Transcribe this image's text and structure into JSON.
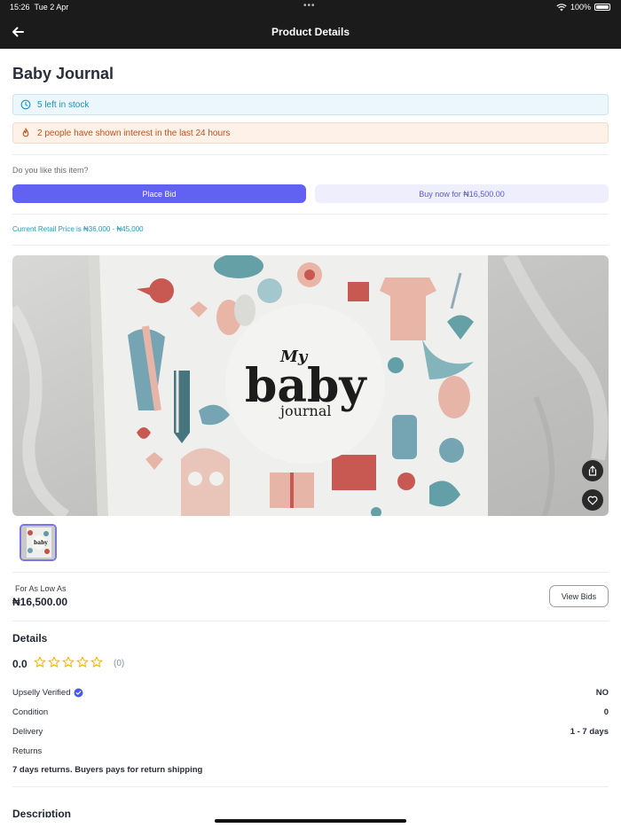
{
  "status_bar": {
    "time": "15:26",
    "date": "Tue 2 Apr",
    "battery": "100%"
  },
  "header": {
    "title": "Product Details"
  },
  "product": {
    "name": "Baby Journal",
    "stock_notice": "5 left in stock",
    "interest_notice": "2 people have shown interest in the last 24 hours",
    "like_question": "Do you like this item?",
    "place_bid_label": "Place Bid",
    "buy_now_label": "Buy now for ₦16,500.00",
    "retail_price_text": "Current Retail Price is ₦36,000 - ₦45,000",
    "cover_text": {
      "line1": "My",
      "line2": "baby",
      "line3": "journal"
    },
    "thumb_text": "baby"
  },
  "pricing": {
    "low_label": "For As Low As",
    "low_price": "₦16,500.00",
    "view_bids_label": "View Bids"
  },
  "details": {
    "heading": "Details",
    "rating_value": "0.0",
    "rating_stars": 0,
    "rating_count": "(0)",
    "rows": [
      {
        "label": "Upselly Verified",
        "value": "NO"
      },
      {
        "label": "Condition",
        "value": "0"
      },
      {
        "label": "Delivery",
        "value": "1 - 7 days"
      },
      {
        "label": "Returns",
        "value": ""
      }
    ],
    "returns_text": "7 days returns. Buyers pays for return shipping"
  },
  "description": {
    "heading": "Description"
  },
  "colors": {
    "accent": "#6161f2",
    "accent_light": "#eeeefc",
    "stock_text": "#1f8fbf",
    "interest_text": "#c0521e",
    "star": "#f5b800",
    "verified_badge": "#4a5ae8"
  }
}
